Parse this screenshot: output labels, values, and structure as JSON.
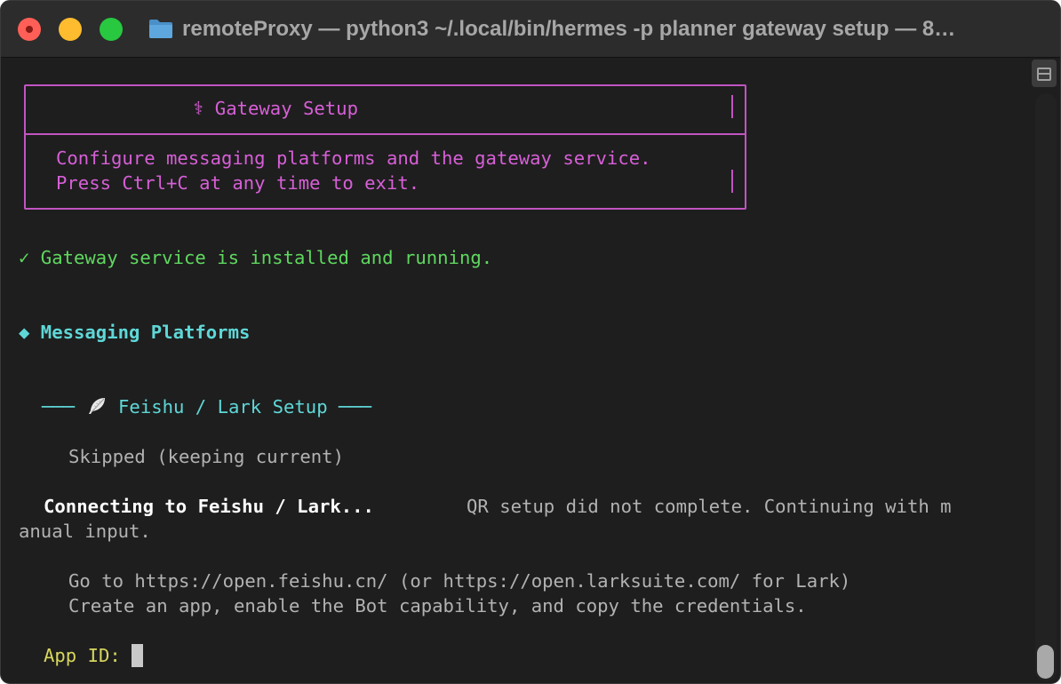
{
  "window": {
    "title": "remoteProxy — python3 ~/.local/bin/hermes -p planner gateway setup — 8…"
  },
  "terminal": {
    "box_title": "⚕ Gateway Setup",
    "box_line1": "Configure messaging platforms and the gateway service.",
    "box_line2": "Press Ctrl+C at any time to exit.",
    "status_ok": "✓ Gateway service is installed and running.",
    "section_heading": "◆ Messaging Platforms",
    "subsection_left": "───",
    "subsection_title": "Feishu / Lark Setup",
    "subsection_right": "───",
    "skipped": "Skipped (keeping current)",
    "connecting": "Connecting to Feishu / Lark...",
    "qr_msg_part1": "QR setup did not complete. Continuing with m",
    "qr_msg_part2": "anual input.",
    "instruction1": "Go to https://open.feishu.cn/ (or https://open.larksuite.com/ for Lark)",
    "instruction2": "Create an app, enable the Bot capability, and copy the credentials.",
    "prompt_label": "App ID:",
    "prompt_value": ""
  },
  "colors": {
    "magenta": "#d75fd7",
    "green": "#5fd75f",
    "cyan": "#5fd7d7",
    "gray": "#b2b2b2",
    "yellow": "#d7d75f",
    "background": "#1e1e1e"
  }
}
